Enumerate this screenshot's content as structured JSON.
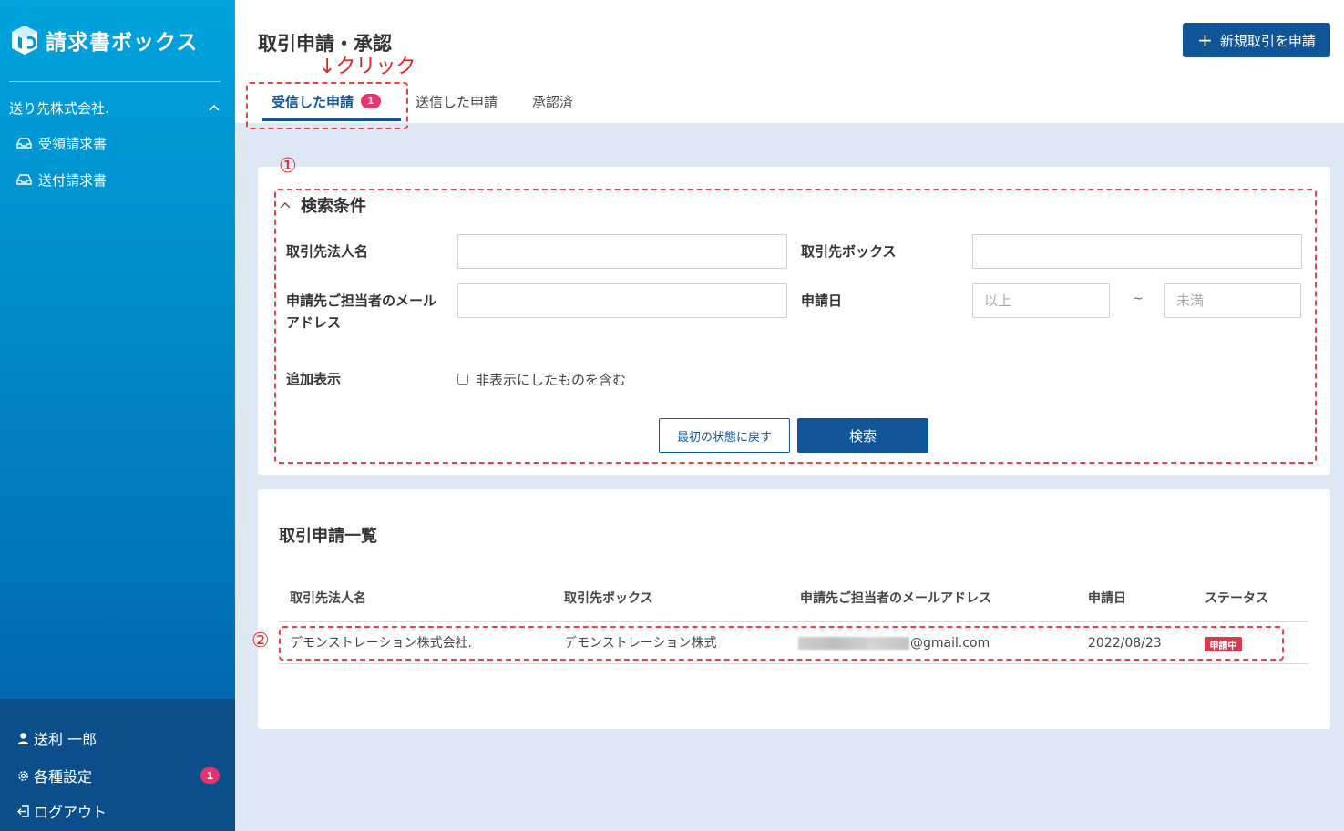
{
  "sidebar": {
    "logo_text": "請求書ボックス",
    "company": "送り先株式会社.",
    "items": [
      {
        "label": "受領請求書",
        "icon": "inbox-icon"
      },
      {
        "label": "送付請求書",
        "icon": "inbox-icon"
      }
    ],
    "bottom": {
      "user": "送利 一郎",
      "settings": "各種設定",
      "settings_badge": "1",
      "logout": "ログアウト"
    }
  },
  "header": {
    "title": "取引申請・承認",
    "new_button": "新規取引を申請",
    "annotation_click": "↓クリック",
    "tabs": [
      {
        "label": "受信した申請",
        "badge": "1",
        "active": true
      },
      {
        "label": "送信した申請",
        "active": false
      },
      {
        "label": "承認済",
        "active": false
      }
    ]
  },
  "annotations": {
    "one": "①",
    "two": "②"
  },
  "search": {
    "heading": "検索条件",
    "partner_name_label": "取引先法人名",
    "partner_box_label": "取引先ボックス",
    "email_label": "申請先ご担当者のメールアドレス",
    "date_label": "申請日",
    "date_from_placeholder": "以上",
    "date_to_placeholder": "未満",
    "date_separator": "~",
    "extra_label": "追加表示",
    "include_hidden_label": "非表示にしたものを含む",
    "reset_button": "最初の状態に戻す",
    "search_button": "検索"
  },
  "list": {
    "title": "取引申請一覧",
    "columns": [
      "取引先法人名",
      "取引先ボックス",
      "申請先ご担当者のメールアドレス",
      "申請日",
      "ステータス"
    ],
    "rows": [
      {
        "partner_name": "デモンストレーション株式会社.",
        "partner_box": "デモンストレーション株式",
        "email_domain": "@gmail.com",
        "date": "2022/08/23",
        "status": "申請中"
      }
    ]
  },
  "colors": {
    "primary": "#0f5598",
    "badge": "#e63471",
    "status": "#d83a4d",
    "annotation": "#e52525"
  }
}
